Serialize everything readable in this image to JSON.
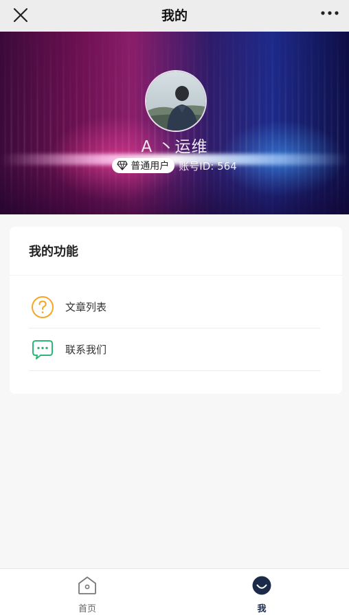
{
  "navbar": {
    "title": "我的",
    "close_icon": "close-icon",
    "more_icon": "more-dots-icon"
  },
  "profile": {
    "name": "A 丶运维",
    "badge_label": "普通用户",
    "badge_icon": "diamond-icon",
    "account_id": "账号ID: 564"
  },
  "functions": {
    "title": "我的功能",
    "items": [
      {
        "label": "文章列表",
        "icon": "question-circle-icon",
        "color": "#f5a623"
      },
      {
        "label": "联系我们",
        "icon": "chat-bubble-icon",
        "color": "#2db774"
      }
    ]
  },
  "tabbar": {
    "tabs": [
      {
        "label": "首页",
        "icon": "home-icon",
        "active": false
      },
      {
        "label": "我",
        "icon": "profile-face-icon",
        "active": true
      }
    ],
    "active_color": "#1c2a4a"
  }
}
